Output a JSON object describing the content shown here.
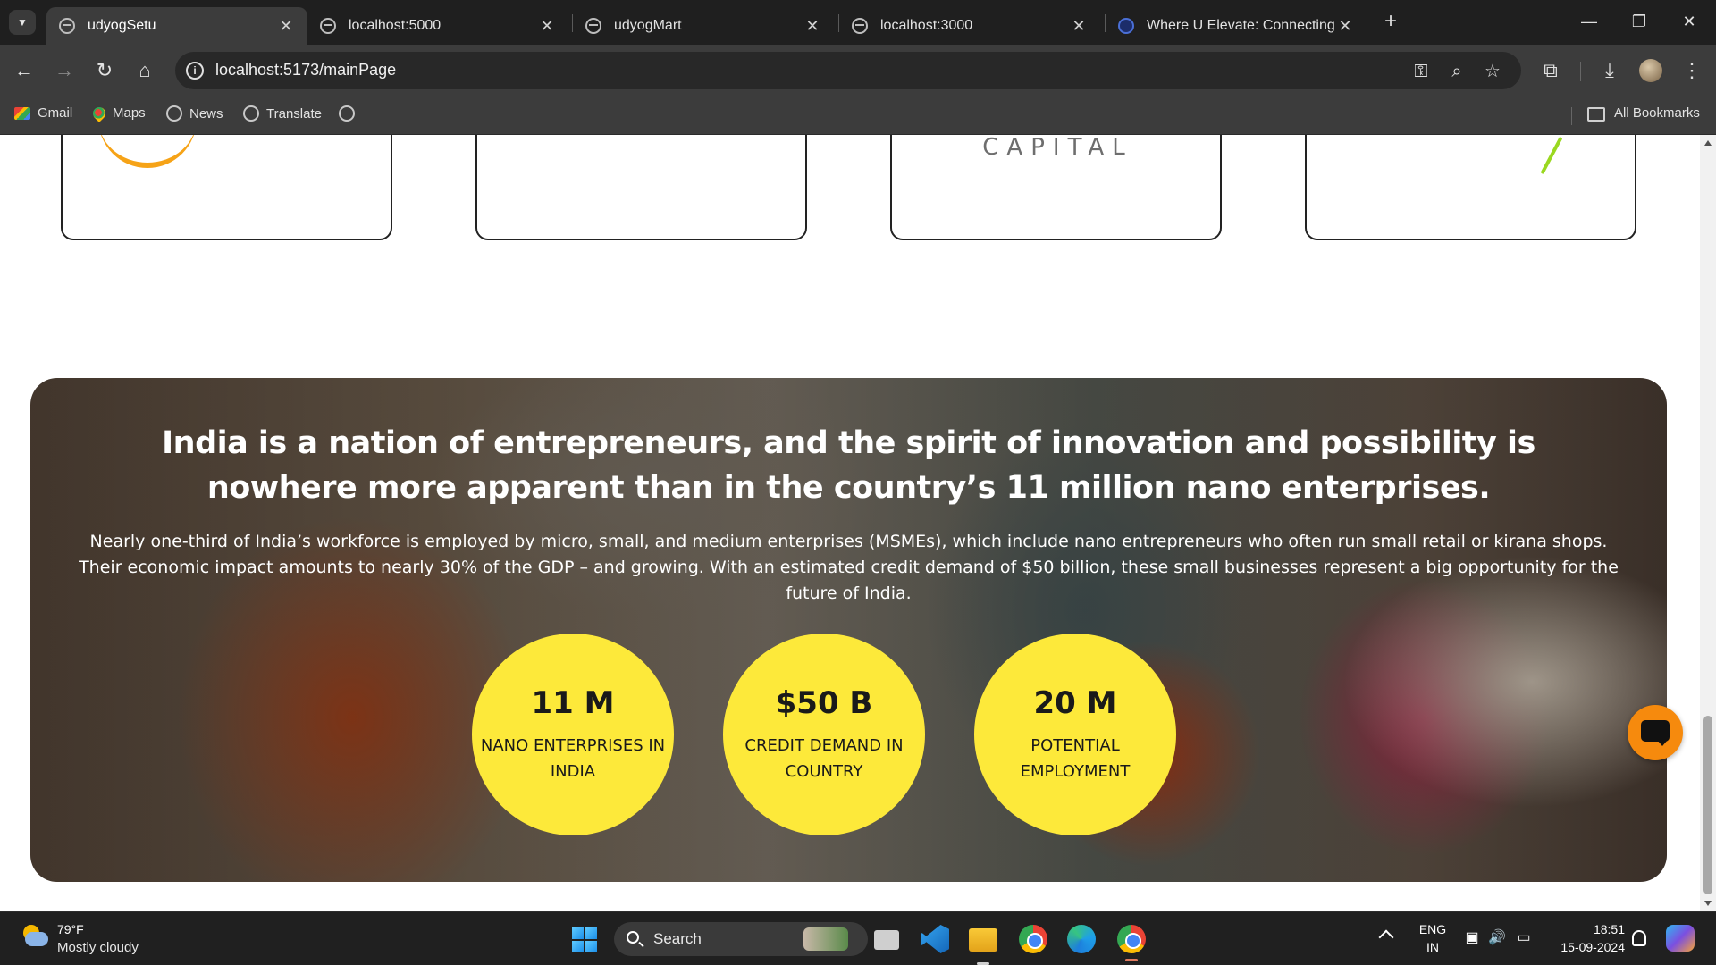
{
  "browser": {
    "tabs": [
      {
        "title": "udyogSetu",
        "active": true
      },
      {
        "title": "localhost:5000",
        "active": false
      },
      {
        "title": "udyogMart",
        "active": false
      },
      {
        "title": "localhost:3000",
        "active": false
      },
      {
        "title": "Where U Elevate: Connecting n",
        "active": false
      }
    ],
    "url": "localhost:5173/mainPage",
    "bookmarks": [
      "Gmail",
      "Maps",
      "News",
      "Translate"
    ],
    "all_bookmarks_label": "All Bookmarks"
  },
  "page": {
    "partner_logo_text": "CAPITAL",
    "hero": {
      "title": "India is a nation of entrepreneurs, and the spirit of innovation and possibility is nowhere more apparent than in the country’s 11 million nano enterprises.",
      "body": "Nearly one-third of India’s workforce is employed by micro, small, and medium enterprises (MSMEs), which include nano entrepreneurs who often run small retail or kirana shops. Their economic impact amounts to nearly 30% of the GDP – and growing. With an estimated credit demand of $50 billion, these small businesses represent a big opportunity for the future of India."
    },
    "stats": [
      {
        "value": "11 M",
        "label": "NANO ENTERPRISES IN INDIA"
      },
      {
        "value": "$50 B",
        "label": "CREDIT DEMAND IN COUNTRY"
      },
      {
        "value": "20 M",
        "label": "POTENTIAL EMPLOYMENT"
      }
    ],
    "colors": {
      "stat_circle": "#fde93a",
      "chat_button": "#f68a0d"
    }
  },
  "taskbar": {
    "weather": {
      "temp": "79°F",
      "desc": "Mostly cloudy"
    },
    "search_placeholder": "Search",
    "language": {
      "line1": "ENG",
      "line2": "IN"
    },
    "time": "18:51",
    "date": "15-09-2024"
  }
}
